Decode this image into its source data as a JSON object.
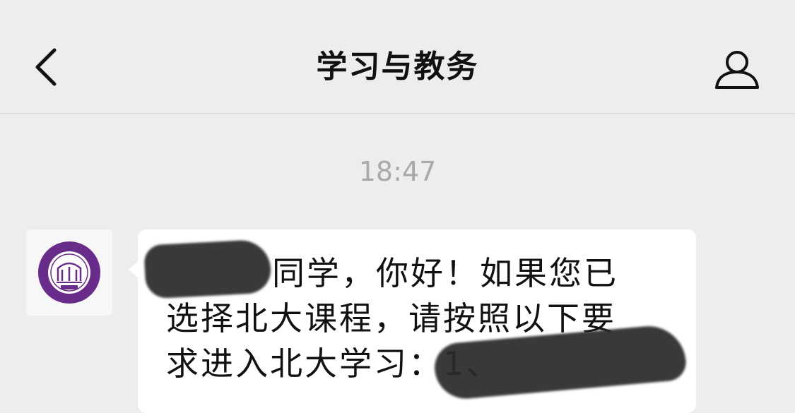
{
  "header": {
    "title": "学习与教务",
    "back_icon": "chevron-left-icon",
    "profile_icon": "user-icon"
  },
  "chat": {
    "timestamp": "18:47",
    "message": {
      "sender_avatar": "university-seal-icon",
      "line1": "同学，你好！如果您已",
      "line2": "选择北大课程，请按照以下要",
      "line3": "求进入北大学习：1、"
    }
  },
  "colors": {
    "background": "#ededed",
    "bubble": "#ffffff",
    "timestamp": "#a9a9a9",
    "avatar_seal": "#6a2c8a"
  }
}
